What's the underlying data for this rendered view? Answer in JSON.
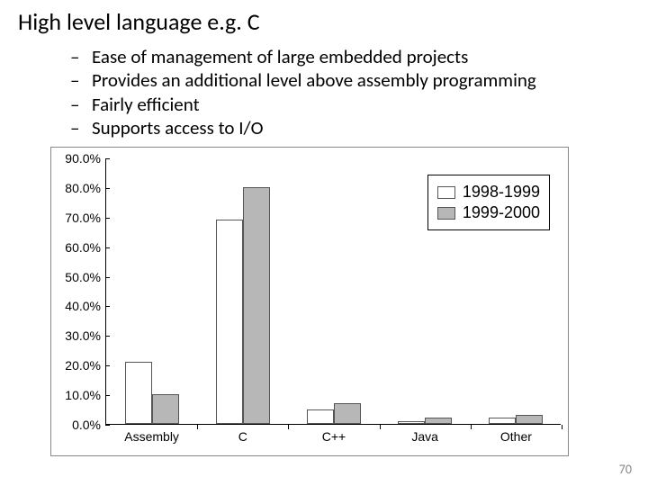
{
  "title": "High level language e.g. C",
  "bullets": [
    "Ease of management of large embedded projects",
    "Provides an additional level above assembly programming",
    "Fairly efficient",
    "Supports access to I/O"
  ],
  "page_number": "70",
  "chart_data": {
    "type": "bar",
    "title": "",
    "xlabel": "",
    "ylabel": "",
    "ylim": [
      0,
      90
    ],
    "yticks": [
      "0.0%",
      "10.0%",
      "20.0%",
      "30.0%",
      "40.0%",
      "50.0%",
      "60.0%",
      "70.0%",
      "80.0%",
      "90.0%"
    ],
    "categories": [
      "Assembly",
      "C",
      "C++",
      "Java",
      "Other"
    ],
    "series": [
      {
        "name": "1998-1999",
        "values": [
          21,
          69,
          5,
          1,
          2
        ]
      },
      {
        "name": "1999-2000",
        "values": [
          10,
          80,
          7,
          2,
          3
        ]
      }
    ]
  }
}
